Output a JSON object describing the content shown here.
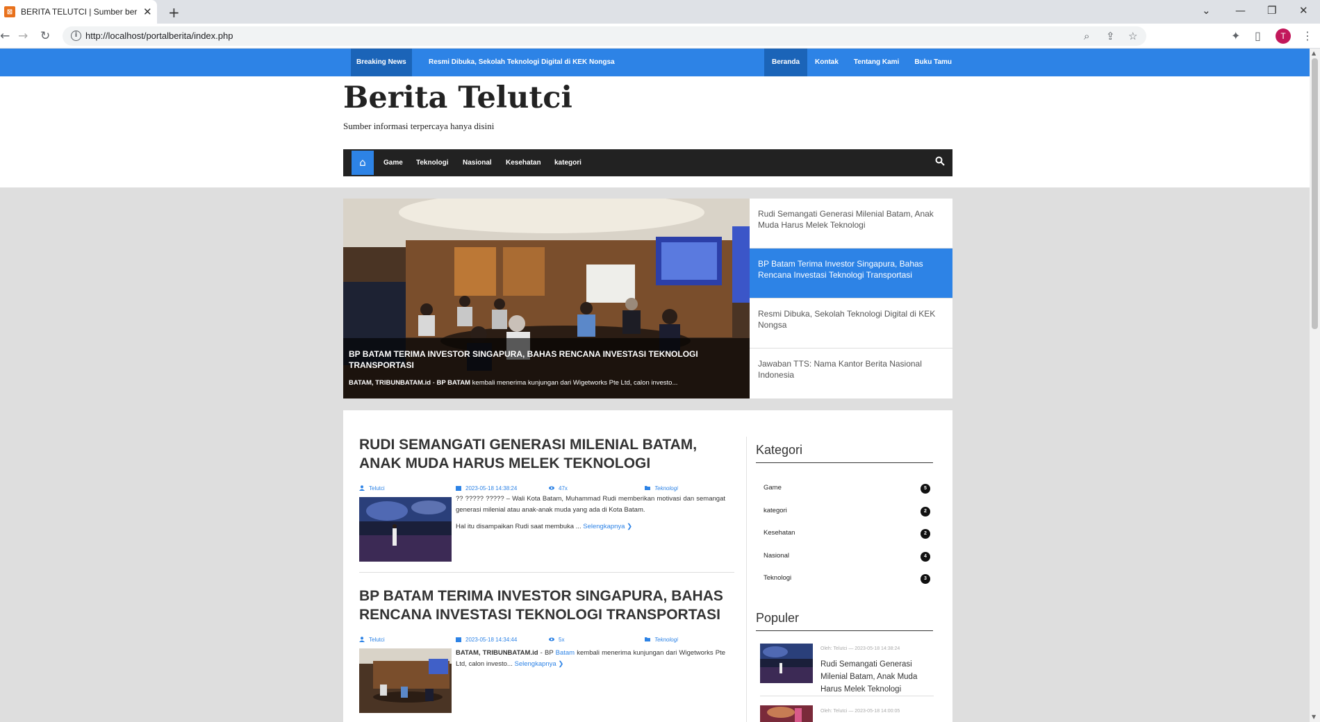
{
  "browser": {
    "tab_title": "BERITA TELUTCI | Sumber berita t",
    "tab_favicon": "xampp-icon",
    "url": "http://localhost/portalberita/index.php",
    "avatar_letter": "T"
  },
  "topbar": {
    "breaking_label": "Breaking News",
    "breaking_text": "Resmi Dibuka, Sekolah Teknologi Digital di KEK Nongsa",
    "nav": [
      {
        "label": "Beranda",
        "active": true
      },
      {
        "label": "Kontak",
        "active": false
      },
      {
        "label": "Tentang Kami",
        "active": false
      },
      {
        "label": "Buku Tamu",
        "active": false
      }
    ]
  },
  "header": {
    "site_title": "Berita Telutci",
    "tagline": "Sumber informasi terpercaya hanya disini"
  },
  "mainnav": {
    "items": [
      "Game",
      "Teknologi",
      "Nasional",
      "Kesehatan",
      "kategori"
    ]
  },
  "featured": {
    "title": "BP BATAM TERIMA INVESTOR SINGAPURA, BAHAS RENCANA INVESTASI TEKNOLOGI TRANSPORTASI",
    "excerpt_bold": "BATAM, TRIBUNBATAM.id",
    "excerpt_mid": " - ",
    "excerpt_bold2": "BP BATAM",
    "excerpt_rest": " kembali menerima kunjungan dari Wigetworks Pte Ltd, calon investo..."
  },
  "slider": [
    {
      "title": "Rudi Semangati Generasi Milenial Batam, Anak Muda Harus Melek Teknologi",
      "active": false
    },
    {
      "title": "BP Batam Terima Investor Singapura, Bahas Rencana Investasi Teknologi Transportasi",
      "active": true
    },
    {
      "title": "Resmi Dibuka, Sekolah Teknologi Digital di KEK Nongsa",
      "active": false
    },
    {
      "title": "Jawaban TTS: Nama Kantor Berita Nasional Indonesia",
      "active": false
    }
  ],
  "posts": [
    {
      "title": "RUDI SEMANGATI GENERASI MILENIAL BATAM, ANAK MUDA HARUS MELEK TEKNOLOGI",
      "author": "Telutci",
      "date": "2023-05-18 14:38:24",
      "views": "47x",
      "category": "Teknologi",
      "excerpt_1": "?? ????? ????? – Wali Kota Batam, Muhammad Rudi memberikan motivasi dan semangat generasi milenial atau anak-anak muda yang ada di Kota Batam.",
      "excerpt_2": "Hal itu disampaikan Rudi saat membuka ... ",
      "more": "Selengkapnya"
    },
    {
      "title": "BP BATAM TERIMA INVESTOR SINGAPURA, BAHAS RENCANA INVESTASI TEKNOLOGI TRANSPORTASI",
      "author": "Telutci",
      "date": "2023-05-18 14:34:44",
      "views": "5x",
      "category": "Teknologi",
      "excerpt_bold": "BATAM, TRIBUNBATAM.id",
      "excerpt_a": " - BP ",
      "excerpt_link": "Batam",
      "excerpt_b": " kembali menerima kunjungan dari Wigetworks Pte Ltd, calon investo... ",
      "more": "Selengkapnya"
    }
  ],
  "sidebar": {
    "kategori_heading": "Kategori",
    "categories": [
      {
        "name": "Game",
        "count": "5"
      },
      {
        "name": "kategori",
        "count": "2"
      },
      {
        "name": "Kesehatan",
        "count": "2"
      },
      {
        "name": "Nasional",
        "count": "4"
      },
      {
        "name": "Teknologi",
        "count": "3"
      }
    ],
    "populer_heading": "Populer",
    "popular": [
      {
        "meta": "Oleh: Telutci — 2023-05-18 14:38:24",
        "title": "Rudi Semangati Generasi Milenial Batam, Anak Muda Harus Melek Teknologi"
      },
      {
        "meta": "Oleh: Telutci — 2023-05-18 14:00:05",
        "title": ""
      }
    ]
  },
  "colors": {
    "accent": "#2d83e6",
    "accent_dark": "#1b64b8",
    "nav_dark": "#222222"
  }
}
